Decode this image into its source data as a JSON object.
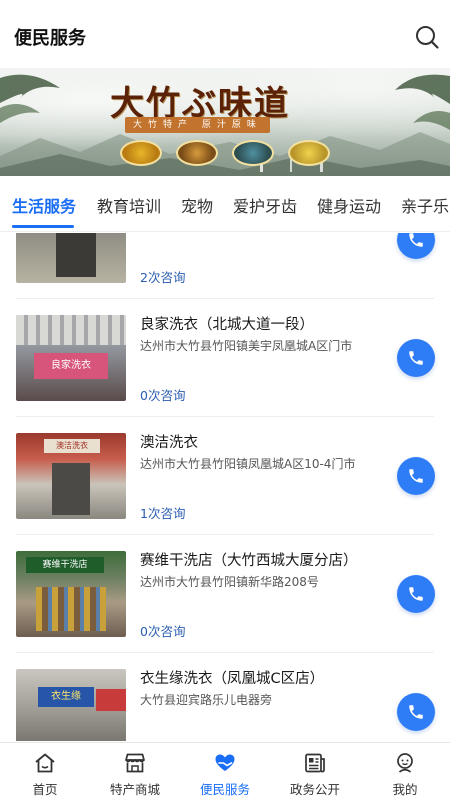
{
  "header": {
    "title": "便民服务"
  },
  "banner": {
    "headline": "大竹ぶ味道",
    "subline": "大竹特产 原汁原味"
  },
  "tabs": [
    {
      "label": "生活服务",
      "active": true
    },
    {
      "label": "教育培训",
      "active": false
    },
    {
      "label": "宠物",
      "active": false
    },
    {
      "label": "爱护牙齿",
      "active": false
    },
    {
      "label": "健身运动",
      "active": false
    },
    {
      "label": "亲子乐园",
      "active": false
    }
  ],
  "listings": [
    {
      "name": "",
      "address": "",
      "consult": "2次咨询"
    },
    {
      "name": "良家洗衣（北城大道一段）",
      "address": "达州市大竹县竹阳镇美宇凤凰城A区门市",
      "consult": "0次咨询",
      "sign": "良家洗衣"
    },
    {
      "name": "澳洁洗衣",
      "address": "达州市大竹县竹阳镇凤凰城A区10-4门市",
      "consult": "1次咨询",
      "sign": "澳洁洗衣"
    },
    {
      "name": "赛维干洗店（大竹西城大厦分店）",
      "address": "达州市大竹县竹阳镇新华路208号",
      "consult": "0次咨询",
      "sign": "赛维干洗店"
    },
    {
      "name": "衣生缘洗衣（凤凰城C区店）",
      "address": "大竹县迎宾路乐儿电器旁",
      "consult": "",
      "sign": "衣生缘"
    }
  ],
  "bottom_nav": [
    {
      "label": "首页",
      "icon": "home-icon",
      "active": false
    },
    {
      "label": "特产商城",
      "icon": "store-icon",
      "active": false
    },
    {
      "label": "便民服务",
      "icon": "heart-hand-icon",
      "active": true
    },
    {
      "label": "政务公开",
      "icon": "newspaper-icon",
      "active": false
    },
    {
      "label": "我的",
      "icon": "profile-icon",
      "active": false
    }
  ],
  "colors": {
    "accent": "#1a6ef5",
    "call_button": "#2f7df6",
    "consult_text": "#2a5db0"
  }
}
